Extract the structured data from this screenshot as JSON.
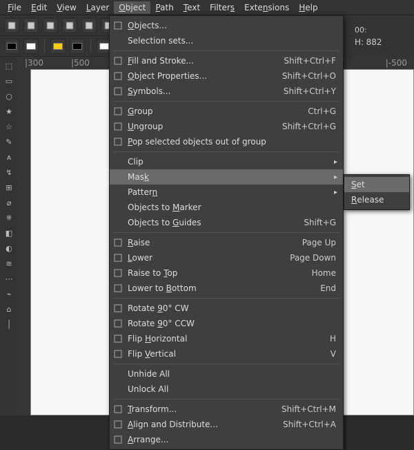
{
  "menubar": {
    "items": [
      {
        "label": "File",
        "ukey": "F"
      },
      {
        "label": "Edit",
        "ukey": "E"
      },
      {
        "label": "View",
        "ukey": "V"
      },
      {
        "label": "Layer",
        "ukey": "L"
      },
      {
        "label": "Object",
        "ukey": "O"
      },
      {
        "label": "Path",
        "ukey": "P"
      },
      {
        "label": "Text",
        "ukey": "T"
      },
      {
        "label": "Filters",
        "ukey": "s"
      },
      {
        "label": "Extensions",
        "ukey": "n"
      },
      {
        "label": "Help",
        "ukey": "H"
      }
    ],
    "open_index": 4
  },
  "readouts": {
    "w": "00:",
    "h_label": "H:",
    "h_value": "882"
  },
  "hruler_ticks": [
    "|300",
    "|500"
  ],
  "hruler_right": "|-500",
  "menu": {
    "sections": [
      [
        {
          "icon": "layers-icon",
          "label": "Objects...",
          "ukey": "O",
          "accel": "",
          "submenu": false
        },
        {
          "icon": "",
          "label": "Selection sets...",
          "ukey": "",
          "accel": "",
          "submenu": false
        }
      ],
      [
        {
          "icon": "fillstroke-icon",
          "label": "Fill and Stroke...",
          "ukey": "F",
          "accel": "Shift+Ctrl+F",
          "submenu": false
        },
        {
          "icon": "props-icon",
          "label": "Object Properties...",
          "ukey": "O",
          "accel": "Shift+Ctrl+O",
          "submenu": false
        },
        {
          "icon": "symbols-icon",
          "label": "Symbols...",
          "ukey": "S",
          "accel": "Shift+Ctrl+Y",
          "submenu": false
        }
      ],
      [
        {
          "icon": "group-icon",
          "label": "Group",
          "ukey": "G",
          "accel": "Ctrl+G",
          "submenu": false
        },
        {
          "icon": "ungroup-icon",
          "label": "Ungroup",
          "ukey": "U",
          "accel": "Shift+Ctrl+G",
          "submenu": false
        },
        {
          "icon": "pop-icon",
          "label": "Pop selected objects out of group",
          "ukey": "P",
          "accel": "",
          "submenu": false
        }
      ],
      [
        {
          "icon": "",
          "label": "Clip",
          "ukey": "",
          "accel": "",
          "submenu": true,
          "hl": false
        },
        {
          "icon": "",
          "label": "Mask",
          "ukey": "k",
          "accel": "",
          "submenu": true,
          "hl": true
        },
        {
          "icon": "",
          "label": "Pattern",
          "ukey": "n",
          "accel": "",
          "submenu": true
        },
        {
          "icon": "",
          "label": "Objects to Marker",
          "ukey": "M",
          "accel": "",
          "submenu": false
        },
        {
          "icon": "",
          "label": "Objects to Guides",
          "ukey": "G",
          "accel": "Shift+G",
          "submenu": false
        }
      ],
      [
        {
          "icon": "raise-icon",
          "label": "Raise",
          "ukey": "R",
          "accel": "Page Up",
          "submenu": false
        },
        {
          "icon": "lower-icon",
          "label": "Lower",
          "ukey": "L",
          "accel": "Page Down",
          "submenu": false
        },
        {
          "icon": "raisetop-icon",
          "label": "Raise to Top",
          "ukey": "T",
          "accel": "Home",
          "submenu": false
        },
        {
          "icon": "lowerbot-icon",
          "label": "Lower to Bottom",
          "ukey": "B",
          "accel": "End",
          "submenu": false
        }
      ],
      [
        {
          "icon": "rotcw-icon",
          "label": "Rotate 90° CW",
          "ukey": "9",
          "accel": "",
          "submenu": false
        },
        {
          "icon": "rotccw-icon",
          "label": "Rotate 90° CCW",
          "ukey": "9",
          "accel": "",
          "submenu": false
        },
        {
          "icon": "fliph-icon",
          "label": "Flip Horizontal",
          "ukey": "H",
          "accel": "H",
          "submenu": false
        },
        {
          "icon": "flipv-icon",
          "label": "Flip Vertical",
          "ukey": "V",
          "accel": "V",
          "submenu": false
        }
      ],
      [
        {
          "icon": "",
          "label": "Unhide All",
          "ukey": "",
          "accel": "",
          "submenu": false
        },
        {
          "icon": "",
          "label": "Unlock All",
          "ukey": "",
          "accel": "",
          "submenu": false
        }
      ],
      [
        {
          "icon": "transform-icon",
          "label": "Transform...",
          "ukey": "T",
          "accel": "Shift+Ctrl+M",
          "submenu": false
        },
        {
          "icon": "align-icon",
          "label": "Align and Distribute...",
          "ukey": "A",
          "accel": "Shift+Ctrl+A",
          "submenu": false
        },
        {
          "icon": "arrange-icon",
          "label": "Arrange...",
          "ukey": "A",
          "accel": "",
          "submenu": false
        }
      ]
    ]
  },
  "submenu": {
    "items": [
      {
        "label": "Set",
        "ukey": "S",
        "hl": true
      },
      {
        "label": "Release",
        "ukey": "R",
        "hl": false
      }
    ]
  },
  "toolbar1_icons": [
    "new",
    "open",
    "save",
    "print",
    "import",
    "export",
    "undo",
    "redo",
    "copy",
    "paste",
    "zoom"
  ],
  "toolbar2_swatches": [
    "#000000",
    "#ffffff",
    "#ffcc00",
    "#000000",
    "#ffffff"
  ],
  "vtools": [
    "⬚",
    "▭",
    "○",
    "★",
    "☆",
    "✎",
    "ᴀ",
    "↯",
    "⊞",
    "⌀",
    "⎈",
    "◧",
    "◐",
    "≋",
    "⋯",
    "⌁",
    "⌂",
    "│"
  ]
}
